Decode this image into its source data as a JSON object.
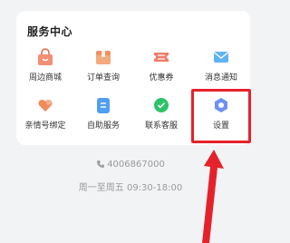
{
  "service_center": {
    "title": "服务中心",
    "items": [
      {
        "label": "周边商城",
        "icon": "shopping-bag-icon"
      },
      {
        "label": "订单查询",
        "icon": "order-box-icon"
      },
      {
        "label": "优惠券",
        "icon": "coupon-icon"
      },
      {
        "label": "消息通知",
        "icon": "envelope-icon"
      },
      {
        "label": "亲情号绑定",
        "icon": "family-heart-icon"
      },
      {
        "label": "自助服务",
        "icon": "self-service-icon"
      },
      {
        "label": "联系客服",
        "icon": "wechat-chat-icon"
      },
      {
        "label": "设置",
        "icon": "gear-icon"
      }
    ]
  },
  "contact": {
    "phone": "4006867000",
    "hours": "周一至周五 09:30-18:00"
  },
  "colors": {
    "highlight": "#e5222b",
    "accent_orange": "#f0836a",
    "accent_blue": "#4fa3f0",
    "accent_green": "#2dc36a",
    "gear_blue": "#6a8ff5"
  }
}
